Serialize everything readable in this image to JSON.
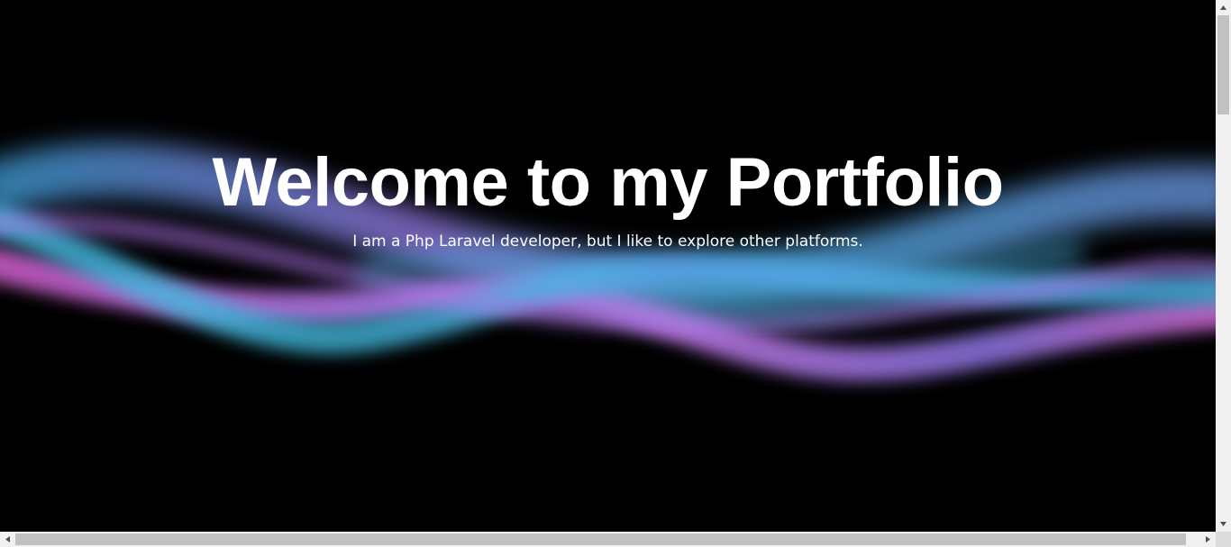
{
  "hero": {
    "title": "Welcome to my Portfolio",
    "subtitle": "I am a Php Laravel developer, but I like to explore other platforms."
  },
  "colors": {
    "background": "#000000",
    "text": "#ffffff",
    "wave_cyan": "#4fb8e8",
    "wave_violet": "#b57cf0",
    "wave_pink": "#e06ad8"
  },
  "icons": {
    "scroll_up": "arrow-up-icon",
    "scroll_down": "arrow-down-icon",
    "scroll_left": "arrow-left-icon",
    "scroll_right": "arrow-right-icon"
  }
}
